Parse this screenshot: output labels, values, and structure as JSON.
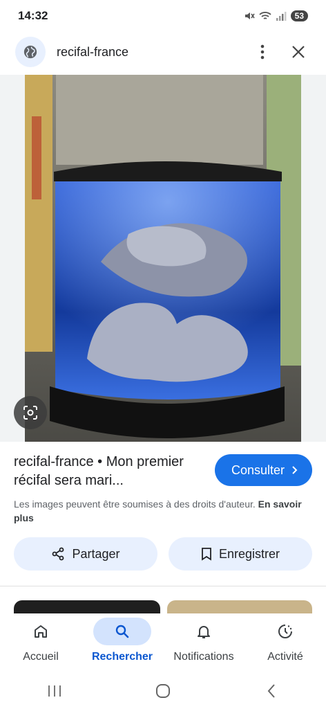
{
  "status": {
    "time": "14:32",
    "battery": "53"
  },
  "header": {
    "site_name": "recifal-france"
  },
  "image": {
    "alt": "Aquarium récifal éclairé en bleu avec pierres vivantes"
  },
  "result": {
    "title": "recifal-france • Mon premier récifal sera mari...",
    "visit_label": "Consulter",
    "copyright_text": "Les images peuvent être soumises à des droits d'auteur.",
    "learn_more": "En savoir plus"
  },
  "actions": {
    "share_label": "Partager",
    "save_label": "Enregistrer"
  },
  "bottom_nav": {
    "items": [
      {
        "label": "Accueil",
        "icon": "home-icon"
      },
      {
        "label": "Rechercher",
        "icon": "search-icon",
        "active": true
      },
      {
        "label": "Notifications",
        "icon": "bell-icon"
      },
      {
        "label": "Activité",
        "icon": "activity-icon"
      }
    ]
  },
  "colors": {
    "accent": "#1a73e8",
    "active_pill": "#d3e3fd",
    "chip_bg": "#e8f0fe"
  }
}
